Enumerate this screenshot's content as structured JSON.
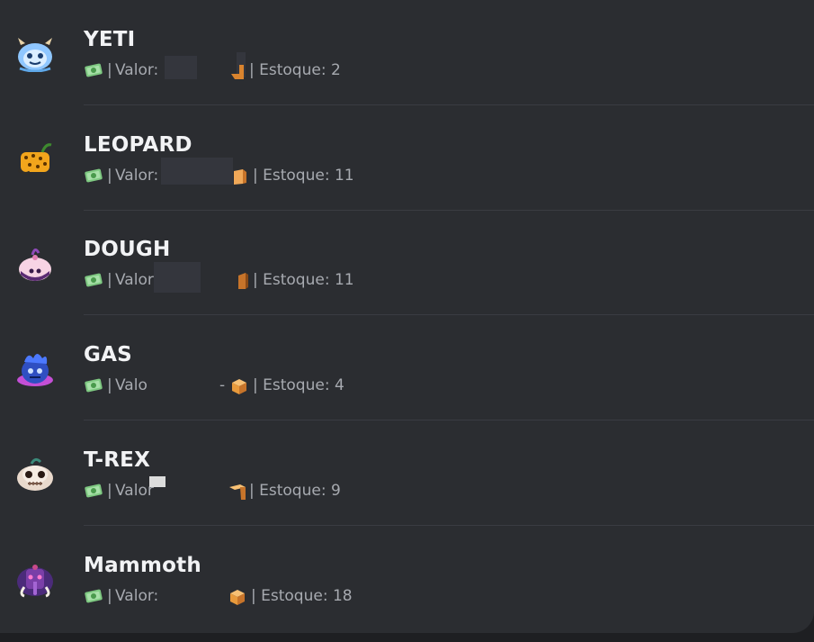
{
  "colors": {
    "panel_bg": "#2b2d31",
    "outer_bg": "#1e1f22",
    "name_text": "#f2f3f5",
    "meta_text": "#a7aab0",
    "divider": "#3a3c42"
  },
  "items": [
    {
      "name": "YETI",
      "avatar_icon": "yeti-fruit-icon",
      "separator": "|",
      "valor_label": "Valor:",
      "estoque_label": "| Estoque: 2"
    },
    {
      "name": "LEOPARD",
      "avatar_icon": "leopard-fruit-icon",
      "separator": "|",
      "valor_label": "Valor:",
      "estoque_label": "| Estoque: 11"
    },
    {
      "name": "DOUGH",
      "avatar_icon": "dough-fruit-icon",
      "separator": "|",
      "valor_label": "Valor",
      "estoque_label": "| Estoque: 11"
    },
    {
      "name": "GAS",
      "avatar_icon": "gas-fruit-icon",
      "separator": "|",
      "valor_label": "Valo",
      "dash": "-",
      "estoque_label": "| Estoque: 4"
    },
    {
      "name": "T-REX",
      "avatar_icon": "t-rex-fruit-icon",
      "separator": "|",
      "valor_label": "Valor",
      "estoque_label": "| Estoque: 9"
    },
    {
      "name": "Mammoth",
      "avatar_icon": "mammoth-fruit-icon",
      "separator": "|",
      "valor_label": "Valor:",
      "estoque_label": "| Estoque: 18"
    }
  ]
}
